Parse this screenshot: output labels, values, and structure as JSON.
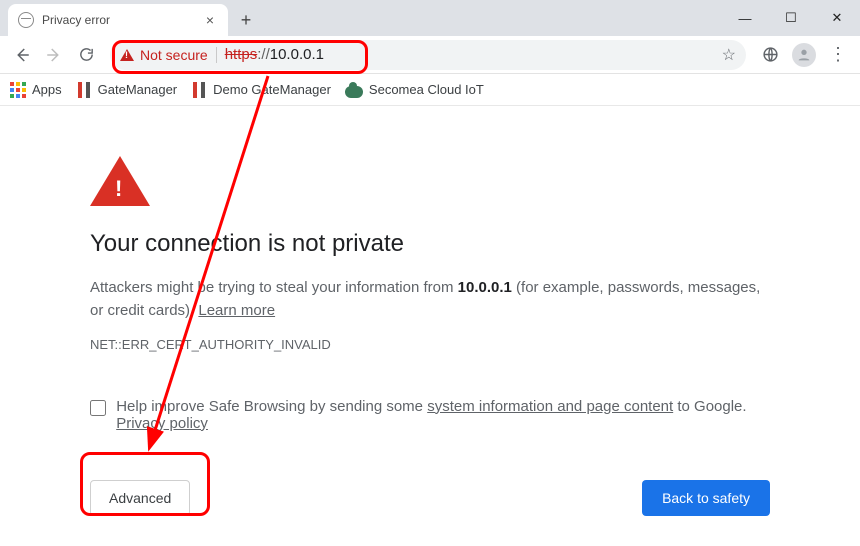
{
  "tab": {
    "title": "Privacy error"
  },
  "addressbar": {
    "not_secure": "Not secure",
    "scheme": "https",
    "sep": "://",
    "host": "10.0.0.1"
  },
  "bookmarks": {
    "apps": "Apps",
    "gm": "GateManager",
    "demo": "Demo GateManager",
    "cloud": "Secomea Cloud IoT"
  },
  "page": {
    "heading": "Your connection is not private",
    "desc_before": "Attackers might be trying to steal your information from ",
    "desc_host": "10.0.0.1",
    "desc_after": " (for example, passwords, messages, or credit cards). ",
    "learn_more": "Learn more",
    "error_code": "NET::ERR_CERT_AUTHORITY_INVALID",
    "sb_before": "Help improve Safe Browsing by sending some ",
    "sb_link1": "system information and page content",
    "sb_mid": " to Google. ",
    "sb_link2": "Privacy policy",
    "advanced": "Advanced",
    "back_to_safety": "Back to safety"
  }
}
